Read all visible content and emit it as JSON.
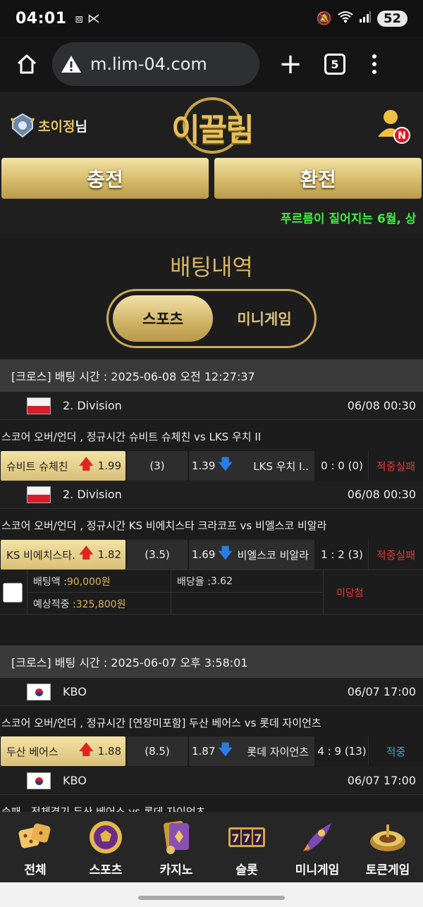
{
  "status_bar": {
    "time": "04:01",
    "battery": "52"
  },
  "browser": {
    "url": "m.lim-04.com",
    "tab_count": "5"
  },
  "header": {
    "user_name": "초이정",
    "user_suffix": "님",
    "logo_text": "이끌림",
    "notification_badge": "N"
  },
  "actions": {
    "charge_label": "충전",
    "exchange_label": "환전"
  },
  "marquee": {
    "text": "푸르름이 짙어지는 6월, 상"
  },
  "page": {
    "title": "배팅내역"
  },
  "tabs": {
    "sports": "스포츠",
    "minigame": "미니게임"
  },
  "bets": [
    {
      "header": "[크로스] 배팅 시간 : 2025-06-08 오전 12:27:37",
      "games": [
        {
          "league": "2. Division",
          "date": "06/08 00:30",
          "title": "스코어 오버/언더 , 정규시간 슈비트 슈체친  vs  LKS 우치 II",
          "home_team": "슈비트 슈체친",
          "home_odd": "1.99",
          "line": "(3)",
          "away_odd": "1.39",
          "away_team": "LKS 우치 I..",
          "score": "0 : 0 (0)",
          "result": "적중실패"
        },
        {
          "league": "2. Division",
          "date": "06/08 00:30",
          "title": "스코어 오버/언더 , 정규시간 KS 비에치스타 크라코프  vs  비엘스코 비알라",
          "home_team": "KS 비에치스타..",
          "home_odd": "1.82",
          "line": "(3.5)",
          "away_odd": "1.69",
          "away_team": "비엘스코 비알라",
          "score": "1 : 2 (3)",
          "result": "적중실패"
        }
      ],
      "summary": {
        "bet_amount_label": "배팅액 : ",
        "bet_amount": "90,000원",
        "odds_label": "배당율 : ",
        "odds": "3.62",
        "expected_label": "예상적중 : ",
        "expected": "325,800원",
        "status": "미당첨"
      }
    },
    {
      "header": "[크로스] 배팅 시간 : 2025-06-07 오후 3:58:01",
      "games": [
        {
          "league": "KBO",
          "date": "06/07 17:00",
          "title": "스코어 오버/언더 , 정규시간 [연장미포함] 두산 베어스  vs  롯데 자이언츠",
          "home_team": "두산 베어스",
          "home_odd": "1.88",
          "line": "(8.5)",
          "away_odd": "1.87",
          "away_team": "롯데 자이언츠",
          "score": "4 : 9 (13)",
          "result": "적중"
        },
        {
          "league": "KBO",
          "date": "06/07 17:00",
          "title": "승패 , 전체경기 두산 베어스  vs  롯데 자이언츠"
        }
      ]
    }
  ],
  "bottom_nav": [
    {
      "label": "전체",
      "icon": "dice-icon"
    },
    {
      "label": "스포츠",
      "icon": "soccer-ball-icon"
    },
    {
      "label": "카지노",
      "icon": "cards-icon"
    },
    {
      "label": "슬롯",
      "icon": "slot-777-icon"
    },
    {
      "label": "미니게임",
      "icon": "rocket-icon"
    },
    {
      "label": "토큰게임",
      "icon": "roulette-icon"
    }
  ],
  "colors": {
    "gold": "#d6b567",
    "fail_red": "#e03a3a",
    "hit_teal": "#3aa7c9",
    "marquee_green": "#3cf03c"
  }
}
